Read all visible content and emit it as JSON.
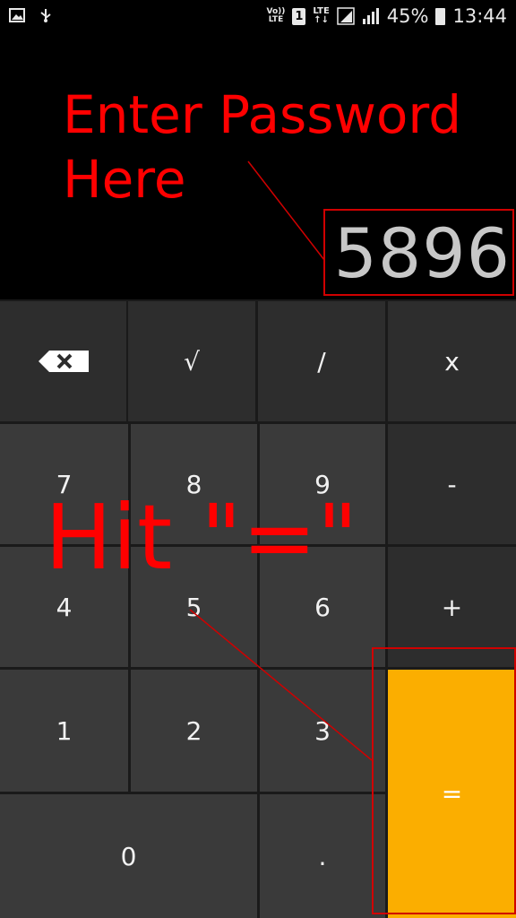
{
  "status_bar": {
    "volte_top": "Vo))",
    "volte_bottom": "LTE",
    "sim": "1",
    "lte": "LTE",
    "battery_percent": "45%",
    "time": "13:44"
  },
  "annotations": {
    "enter_line1": "Enter Password",
    "enter_line2": "Here",
    "hit": "Hit \"=\""
  },
  "display": {
    "value": "5896"
  },
  "keys": {
    "backspace": "backspace-icon",
    "sqrt": "√",
    "divide": "/",
    "multiply": "x",
    "k7": "7",
    "k8": "8",
    "k9": "9",
    "minus": "-",
    "k4": "4",
    "k5": "5",
    "k6": "6",
    "plus": "+",
    "k1": "1",
    "k2": "2",
    "k3": "3",
    "equals": "=",
    "k0": "0",
    "dot": "."
  },
  "colors": {
    "annotation": "#ff0000",
    "equals_key": "#fbae00",
    "key_bg": "#3a3a3a",
    "op_key_bg": "#2d2d2d"
  }
}
